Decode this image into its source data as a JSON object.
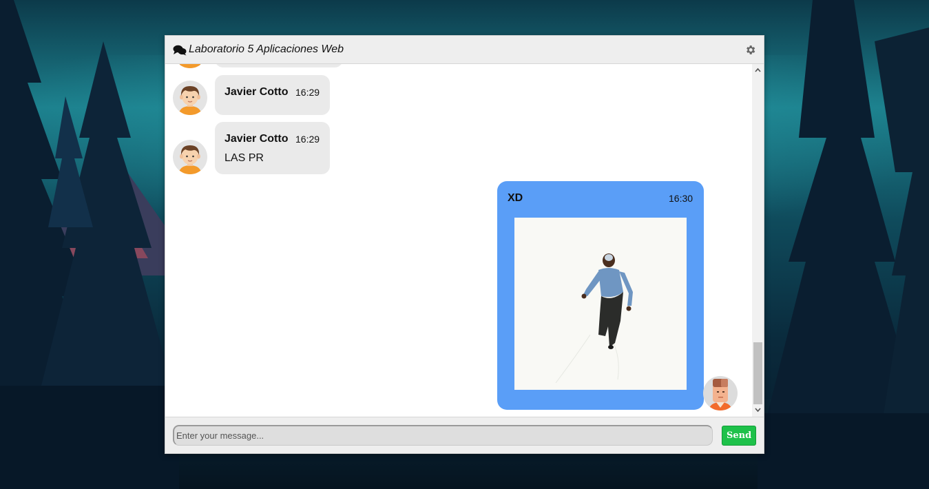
{
  "header": {
    "title": "Laboratorio 5 Aplicaciones Web",
    "chat_icon": "comments-icon",
    "settings_icon": "gear-icon"
  },
  "messages": [
    {
      "sender": "Javier Cotto",
      "time": "16:29",
      "text": "",
      "direction": "incoming"
    },
    {
      "sender": "Javier Cotto",
      "time": "16:29",
      "text": "LAS PR",
      "direction": "incoming"
    },
    {
      "sender": "XD",
      "time": "16:30",
      "direction": "outgoing",
      "attachment": "image"
    }
  ],
  "footer": {
    "input_placeholder": "Enter your message...",
    "input_value": "",
    "send_label": "Send"
  },
  "colors": {
    "outgoing_bubble": "#5a9ef7",
    "incoming_bubble": "#eaeaea",
    "send_button": "#1ec14a"
  }
}
